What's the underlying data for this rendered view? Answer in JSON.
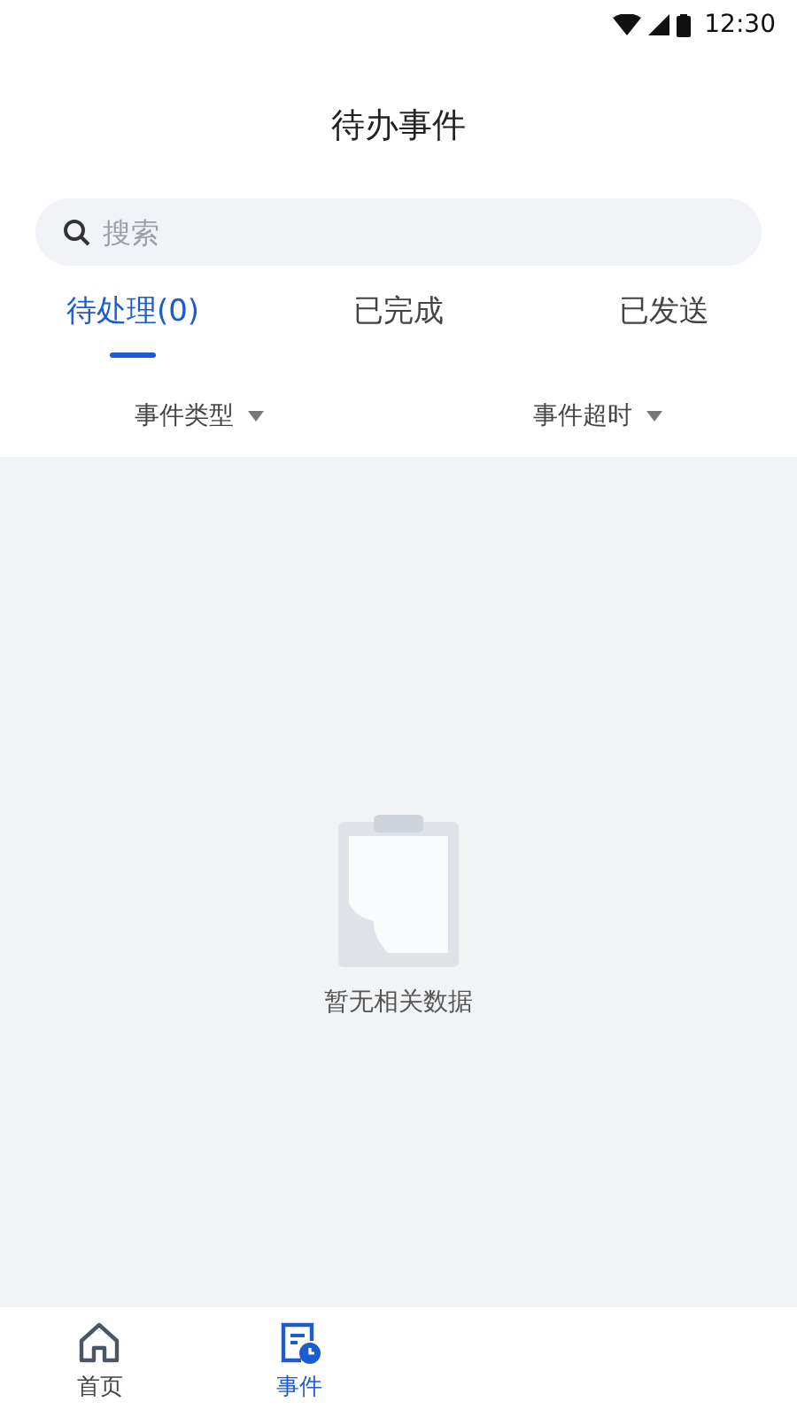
{
  "status_bar": {
    "time": "12:30"
  },
  "title": "待办事件",
  "search": {
    "placeholder": "搜索"
  },
  "tabs": [
    {
      "label": "待处理(0)",
      "selected": true
    },
    {
      "label": "已完成",
      "selected": false
    },
    {
      "label": "已发送",
      "selected": false
    }
  ],
  "filters": [
    {
      "label": "事件类型"
    },
    {
      "label": "事件超时"
    }
  ],
  "empty_state": {
    "message": "暂无相关数据"
  },
  "bottom_nav": [
    {
      "label": "首页",
      "kind": "home",
      "selected": false
    },
    {
      "label": "事件",
      "kind": "events",
      "selected": true
    }
  ]
}
